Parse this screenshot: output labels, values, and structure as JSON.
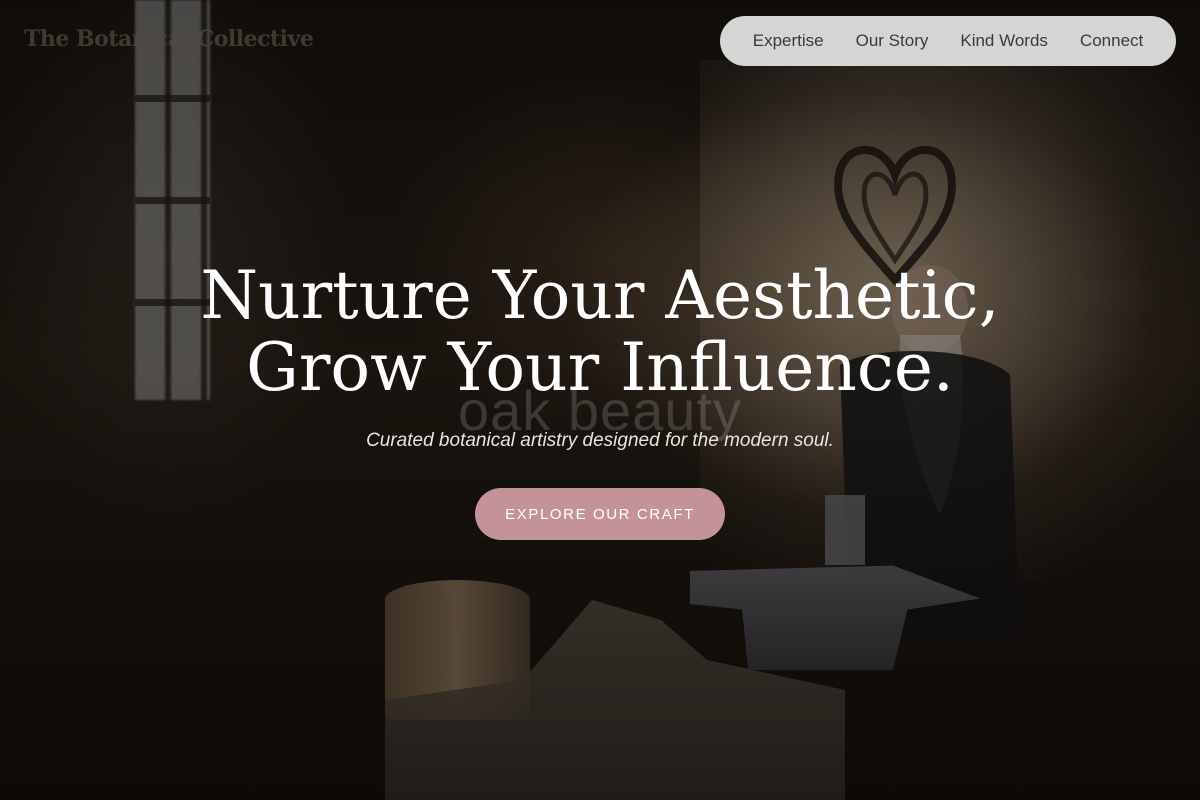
{
  "brand": {
    "name": "The Botanical Collective"
  },
  "nav": {
    "items": [
      {
        "label": "Expertise"
      },
      {
        "label": "Our Story"
      },
      {
        "label": "Kind Words"
      },
      {
        "label": "Connect"
      }
    ]
  },
  "hero": {
    "headline_line1": "Nurture Your Aesthetic,",
    "headline_line2": "Grow Your Influence.",
    "watermark": "oak beauty",
    "subtitle": "Curated botanical artistry designed for the modern soul.",
    "cta_label": "EXPLORE OUR CRAFT",
    "background_description_icon": "workshop-photo-background"
  },
  "colors": {
    "accent": "#c39398",
    "nav_bg": "#e6e6e6",
    "headline": "#ffffff"
  }
}
